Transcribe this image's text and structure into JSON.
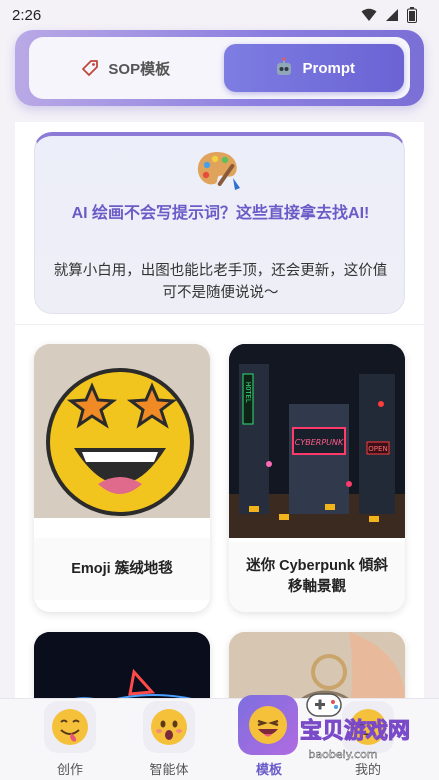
{
  "status_bar": {
    "time": "2:26"
  },
  "tabs": [
    {
      "label": "SOP模板",
      "icon": "tag-icon",
      "active": false
    },
    {
      "label": "Prompt",
      "icon": "robot-icon",
      "active": true
    }
  ],
  "intro": {
    "icon": "palette-icon",
    "title": "AI 绘画不会写提示词？这些直接拿去找AI!",
    "description": "就算小白用，出图也能比老手顶，还会更新，这价值可不是随便说说～"
  },
  "cards": [
    {
      "caption": "Emoji 簇绒地毯"
    },
    {
      "caption": "迷你 Cyberpunk 傾斜移軸景觀"
    },
    {
      "caption": ""
    },
    {
      "caption": ""
    }
  ],
  "cyberpunk_sign": {
    "hotel": "HOTEL",
    "cyber": "CYBERPUNK",
    "open": "OPEN"
  },
  "bottom_nav": [
    {
      "label": "创作",
      "icon": "smiley-tongue-icon",
      "active": false
    },
    {
      "label": "智能体",
      "icon": "surprised-face-icon",
      "active": false
    },
    {
      "label": "模板",
      "icon": "wink-face-icon",
      "active": true
    },
    {
      "label": "我的",
      "icon": "profile-face-icon",
      "active": false
    }
  ],
  "watermark": {
    "text": "宝贝游戏网",
    "url": "baobeiy.com"
  },
  "colors": {
    "accent": "#6a5cc8",
    "tab_active": "#6b63d4"
  }
}
